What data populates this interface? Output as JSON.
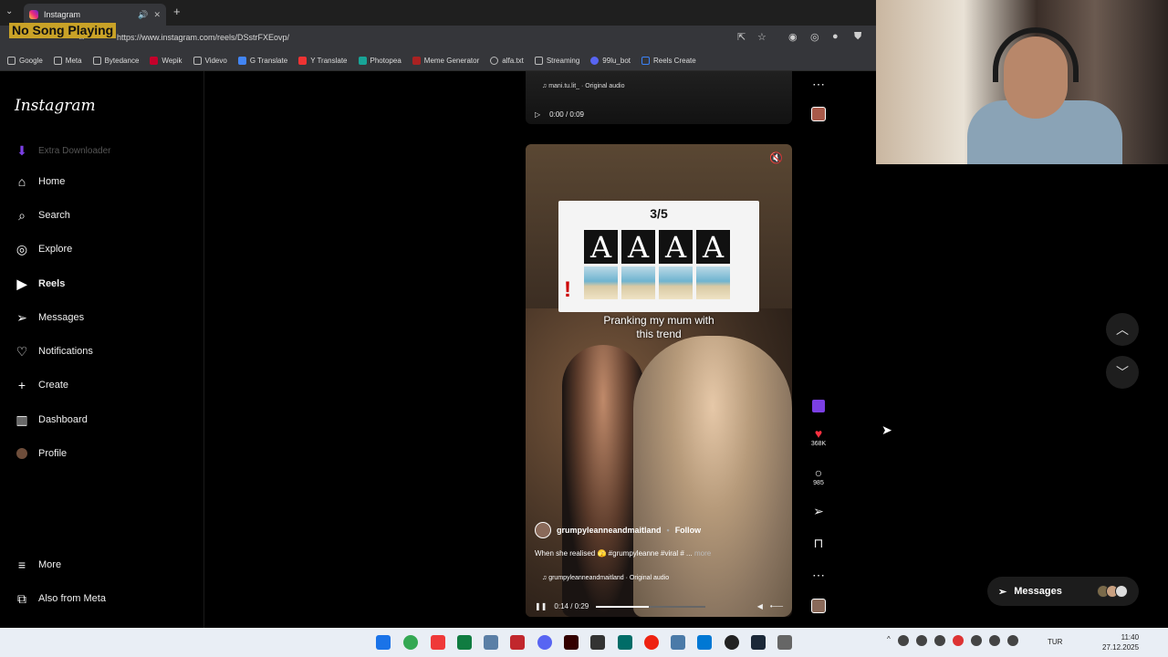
{
  "browser": {
    "tab_title": "Instagram",
    "url": "https://www.instagram.com/reels/DSstrFXEovp/",
    "overlay_text": "No Song Playing",
    "bookmarks": [
      "Google",
      "Meta",
      "Bytedance",
      "Wepik",
      "Videvo",
      "G Translate",
      "Y Translate",
      "Photopea",
      "Meme Generator",
      "alfa.txt",
      "Streaming",
      "99lu_bot",
      "Reels Create"
    ]
  },
  "sidebar": {
    "logo": "Instagram",
    "extension": "Extra Downloader",
    "items": [
      {
        "label": "Home",
        "icon": "home-icon"
      },
      {
        "label": "Search",
        "icon": "search-icon"
      },
      {
        "label": "Explore",
        "icon": "compass-icon"
      },
      {
        "label": "Reels",
        "icon": "reels-icon"
      },
      {
        "label": "Messages",
        "icon": "send-icon"
      },
      {
        "label": "Notifications",
        "icon": "heart-icon"
      },
      {
        "label": "Create",
        "icon": "plus-icon"
      },
      {
        "label": "Dashboard",
        "icon": "chart-icon"
      },
      {
        "label": "Profile",
        "icon": "avatar-icon"
      }
    ],
    "more": "More",
    "also_from_meta": "Also from Meta"
  },
  "prev_reel": {
    "music": "mani.tu.lit_ · Original audio",
    "time": "0:00 / 0:09"
  },
  "reel": {
    "game_count": "3/5",
    "letters": [
      "A",
      "A",
      "A",
      "A"
    ],
    "caption_overlay_line1": "Pranking my mum with",
    "caption_overlay_line2": "this trend",
    "author": "grumpyleanneandmaitland",
    "follow": "Follow",
    "description": "When she realised 🫣 #grumpyleanne #viral # ...",
    "more": "more",
    "music": "grumpyleanneandmaitland · Original audio",
    "time": "0:14 / 0:29",
    "progress": 0.48
  },
  "actions": {
    "likes": "368K",
    "comments": "985"
  },
  "messages_pill": "Messages",
  "taskbar": {
    "lang": "TUR",
    "time": "11:40",
    "date": "27.12.2025"
  }
}
